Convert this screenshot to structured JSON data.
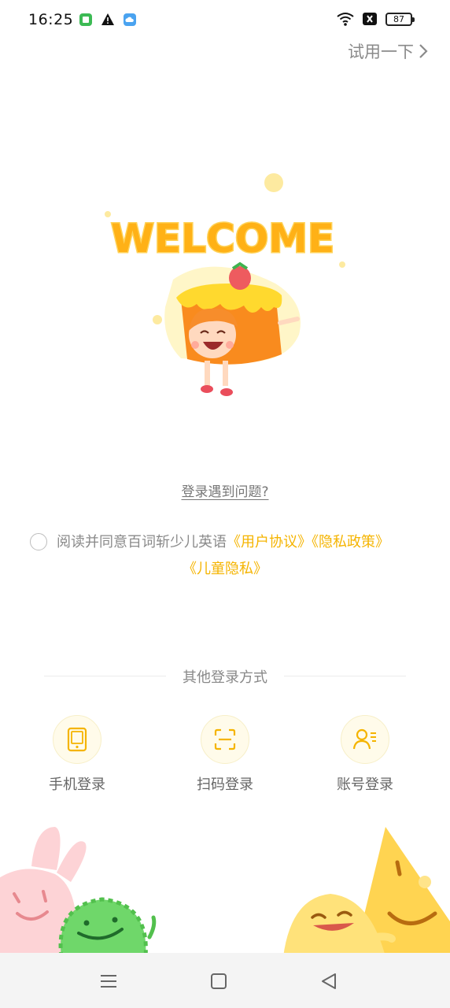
{
  "status_bar": {
    "time": "16:25",
    "battery": "87",
    "icons_left": [
      "app-notification-icon",
      "warning-icon",
      "cloud-app-icon"
    ],
    "icons_right": [
      "wifi-icon",
      "close-box-icon",
      "battery-icon"
    ]
  },
  "header": {
    "try_label": "试用一下"
  },
  "illustration": {
    "welcome_text": "WELCOME"
  },
  "login_problem": {
    "label": "登录遇到问题?"
  },
  "agreement": {
    "prefix": "阅读并同意百词斩少儿英语",
    "user_agreement": "《用户协议》",
    "privacy_policy": "《隐私政策》",
    "child_privacy": "《儿童隐私》",
    "checked": false
  },
  "other_login": {
    "title": "其他登录方式",
    "options": [
      {
        "label": "手机登录",
        "icon": "phone-icon"
      },
      {
        "label": "扫码登录",
        "icon": "scan-icon"
      },
      {
        "label": "账号登录",
        "icon": "account-icon"
      }
    ]
  },
  "colors": {
    "accent": "#f5b400",
    "muted_text": "#8a8a8a",
    "icon_circle_bg": "#fffbea"
  },
  "nav_bar": {
    "buttons": [
      "menu-icon",
      "home-icon",
      "back-icon"
    ]
  }
}
